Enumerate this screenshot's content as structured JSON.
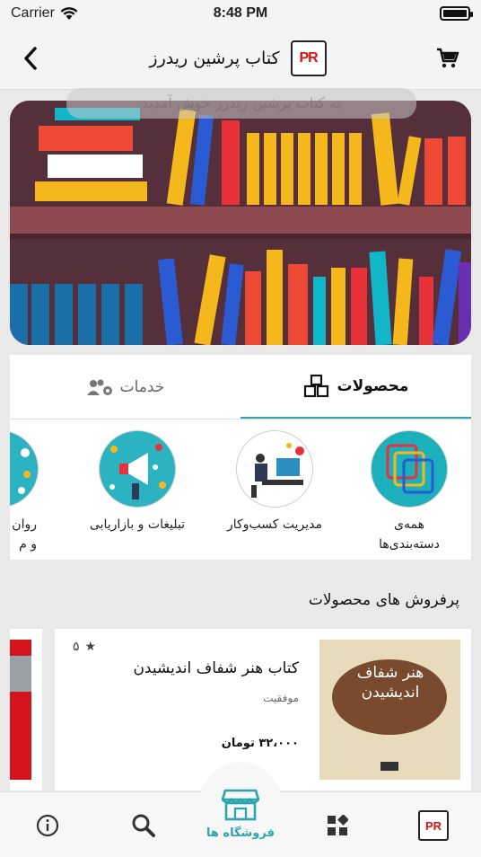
{
  "status_bar": {
    "carrier": "Carrier",
    "time": "8:48 PM"
  },
  "header": {
    "title": "کتاب پرشین ریدرز",
    "logo_text": "PR"
  },
  "toast": {
    "text": "به کتاب پرشین ریدرز خوش آمدید"
  },
  "tabs": {
    "products": "محصولات",
    "services": "خدمات"
  },
  "categories": [
    {
      "label_line1": "همه‌ی",
      "label_line2": "دسته‌بندی‌ها"
    },
    {
      "label_line1": "مدیریت کسب‌وکار",
      "label_line2": ""
    },
    {
      "label_line1": "تبلیغات و بازاریابی",
      "label_line2": ""
    },
    {
      "label_line1": "روان",
      "label_line2": "و م"
    }
  ],
  "section": {
    "bestsellers": "پرفروش های محصولات"
  },
  "product": {
    "name": "کتاب هنر شفاف اندیشیدن",
    "author": "موفقیت",
    "price": "۳۲،۰۰۰ تومان",
    "rating": "۵",
    "cover_title": "هنر شفاف اندیشیدن"
  },
  "bottom_nav": {
    "store_label": "فروشگاه ها"
  },
  "colors": {
    "accent": "#2aa6b0",
    "banner_bg": "#552f3a"
  }
}
